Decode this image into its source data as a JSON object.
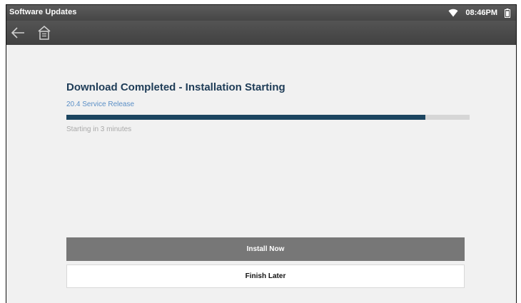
{
  "status_bar": {
    "app_title": "Software Updates",
    "time": "08:46PM",
    "icons": [
      "wifi-icon",
      "battery-icon"
    ]
  },
  "nav": {
    "icons": [
      "back-arrow-icon",
      "home-icon"
    ]
  },
  "update": {
    "heading": "Download Completed - Installation Starting",
    "release": "20.4 Service Release",
    "progress_percent": 89,
    "status": "Starting in 3 minutes"
  },
  "actions": {
    "install_now": "Install Now",
    "finish_later": "Finish Later"
  },
  "colors": {
    "heading": "#1e3c57",
    "release_link": "#5b8fc6",
    "progress_fill": "#1c4560",
    "progress_track": "#d6d6d6",
    "primary_button": "#777777"
  }
}
